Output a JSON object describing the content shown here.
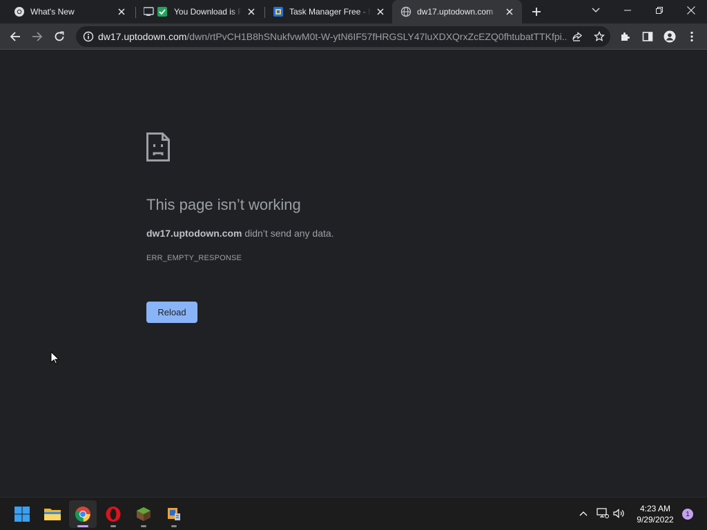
{
  "browser": {
    "tabs": [
      {
        "title": "What's New",
        "favicon": "chrome-icon",
        "active": false
      },
      {
        "title": "You Download is Ready",
        "favicon": "download-check-icon",
        "active": false
      },
      {
        "title": "Task Manager Free - Monitor",
        "favicon": "task-manager-icon",
        "active": false
      },
      {
        "title": "dw17.uptodown.com",
        "favicon": "globe-icon",
        "active": true
      }
    ],
    "address_bar": {
      "host": "dw17.uptodown.com",
      "path": "/dwn/rtPvCH1B8hSNukfvwM0t-W-ytN6IF57fHRGSLY47luXDXQrxZcEZQ0fhtubatTTKfpi..."
    },
    "icons": [
      "back-icon",
      "forward-icon",
      "reload-icon",
      "info-icon",
      "share-icon",
      "star-icon",
      "extensions-icon",
      "side-panel-icon",
      "profile-icon",
      "menu-icon"
    ]
  },
  "error_page": {
    "title": "This page isn’t working",
    "host": "dw17.uptodown.com",
    "message": " didn’t send any data.",
    "error_code": "ERR_EMPTY_RESPONSE",
    "reload_label": "Reload"
  },
  "taskbar": {
    "apps": [
      "start-icon",
      "file-explorer-icon",
      "chrome-icon",
      "opera-icon",
      "minecraft-icon",
      "task-manager-app-icon"
    ],
    "clock": {
      "time": "4:23 AM",
      "date": "9/29/2022"
    },
    "notification_count": "1"
  },
  "colors": {
    "accent": "#8ab4f8",
    "page_bg": "#202124",
    "toolbar_bg": "#35363a"
  }
}
